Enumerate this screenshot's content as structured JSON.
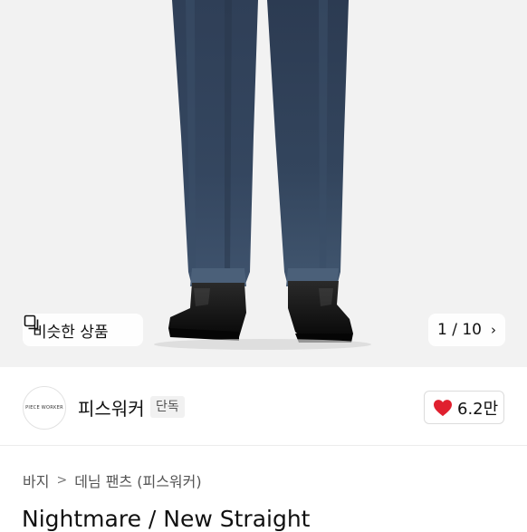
{
  "hero": {
    "similar_label": "비슷한 상품",
    "counter": "1 / 10",
    "counter_chevron": "›"
  },
  "seller": {
    "logo_text": "PIECE WORKER",
    "name": "피스워커",
    "badge": "단독",
    "likes": "6.2만",
    "like_color": "#e0202f"
  },
  "breadcrumb": {
    "category": "바지",
    "separator": ">",
    "subcategory": "데님 팬츠 (피스워커)"
  },
  "product": {
    "title": "Nightmare / New Straight"
  }
}
